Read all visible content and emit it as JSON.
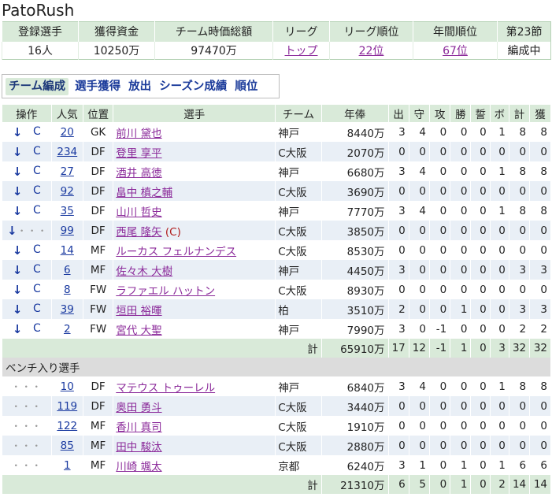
{
  "title": "PatoRush",
  "summary": {
    "headers": [
      "登録選手",
      "獲得資金",
      "チーム時価総額",
      "リーグ",
      "リーグ順位",
      "年間順位",
      "第23節"
    ],
    "values": [
      "16人",
      "10250万",
      "97470万",
      "トップ",
      "22位",
      "67位",
      "編成中"
    ]
  },
  "tabs": [
    "チーム編成",
    "選手獲得",
    "放出",
    "シーズン成績",
    "順位"
  ],
  "roster": {
    "headers": [
      "操作",
      "人気",
      "位置",
      "選手",
      "チーム",
      "年俸",
      "出",
      "守",
      "攻",
      "勝",
      "誓",
      "ボ",
      "計",
      "獲"
    ],
    "op_down": "↓",
    "op_c": "C",
    "op_dots": "・・・",
    "captain_mark": "(C)",
    "starters": [
      {
        "pop": "20",
        "pos": "GK",
        "name": "前川 黛也",
        "team": "神戸",
        "salary": "8440万",
        "s": [
          "3",
          "4",
          "0",
          "0",
          "0",
          "1",
          "8",
          "8"
        ],
        "ops": "arrow-c"
      },
      {
        "pop": "234",
        "pos": "DF",
        "name": "登里 享平",
        "team": "C大阪",
        "salary": "2070万",
        "s": [
          "0",
          "0",
          "0",
          "0",
          "0",
          "0",
          "0",
          "0"
        ],
        "ops": "arrow-c"
      },
      {
        "pop": "27",
        "pos": "DF",
        "name": "酒井 高徳",
        "team": "神戸",
        "salary": "6680万",
        "s": [
          "3",
          "4",
          "0",
          "0",
          "0",
          "1",
          "8",
          "8"
        ],
        "ops": "arrow-c"
      },
      {
        "pop": "92",
        "pos": "DF",
        "name": "畠中 槙之輔",
        "team": "C大阪",
        "salary": "3690万",
        "s": [
          "0",
          "0",
          "0",
          "0",
          "0",
          "0",
          "0",
          "0"
        ],
        "ops": "arrow-c"
      },
      {
        "pop": "35",
        "pos": "DF",
        "name": "山川 哲史",
        "team": "神戸",
        "salary": "7770万",
        "s": [
          "3",
          "4",
          "0",
          "0",
          "0",
          "1",
          "8",
          "8"
        ],
        "ops": "arrow-c"
      },
      {
        "pop": "99",
        "pos": "DF",
        "name": "西尾 隆矢",
        "team": "C大阪",
        "salary": "3850万",
        "s": [
          "0",
          "0",
          "0",
          "0",
          "0",
          "0",
          "0",
          "0"
        ],
        "ops": "arrow-dots",
        "captain": true
      },
      {
        "pop": "14",
        "pos": "MF",
        "name": "ルーカス フェルナンデス",
        "team": "C大阪",
        "salary": "8530万",
        "s": [
          "0",
          "0",
          "0",
          "0",
          "0",
          "0",
          "0",
          "0"
        ],
        "ops": "arrow-c"
      },
      {
        "pop": "6",
        "pos": "MF",
        "name": "佐々木 大樹",
        "team": "神戸",
        "salary": "4450万",
        "s": [
          "3",
          "0",
          "0",
          "0",
          "0",
          "0",
          "3",
          "3"
        ],
        "ops": "arrow-c"
      },
      {
        "pop": "8",
        "pos": "FW",
        "name": "ラファエル ハットン",
        "team": "C大阪",
        "salary": "8930万",
        "s": [
          "0",
          "0",
          "0",
          "0",
          "0",
          "0",
          "0",
          "0"
        ],
        "ops": "arrow-c"
      },
      {
        "pop": "39",
        "pos": "FW",
        "name": "垣田 裕暉",
        "team": "柏",
        "salary": "3510万",
        "s": [
          "2",
          "0",
          "0",
          "1",
          "0",
          "0",
          "3",
          "3"
        ],
        "ops": "arrow-c"
      },
      {
        "pop": "2",
        "pos": "FW",
        "name": "宮代 大聖",
        "team": "神戸",
        "salary": "7990万",
        "s": [
          "3",
          "0",
          "-1",
          "0",
          "0",
          "0",
          "2",
          "2"
        ],
        "ops": "arrow-c"
      }
    ],
    "starters_total": {
      "label": "計",
      "salary": "65910万",
      "s": [
        "17",
        "12",
        "-1",
        "1",
        "0",
        "3",
        "32",
        "32"
      ]
    },
    "bench_label": "ベンチ入り選手",
    "bench": [
      {
        "pop": "10",
        "pos": "DF",
        "name": "マテウス トゥーレル",
        "team": "神戸",
        "salary": "6840万",
        "s": [
          "3",
          "4",
          "0",
          "0",
          "0",
          "1",
          "8",
          "8"
        ],
        "ops": "dots"
      },
      {
        "pop": "119",
        "pos": "DF",
        "name": "奥田 勇斗",
        "team": "C大阪",
        "salary": "3440万",
        "s": [
          "0",
          "0",
          "0",
          "0",
          "0",
          "0",
          "0",
          "0"
        ],
        "ops": "dots"
      },
      {
        "pop": "122",
        "pos": "MF",
        "name": "香川 真司",
        "team": "C大阪",
        "salary": "1910万",
        "s": [
          "0",
          "0",
          "0",
          "0",
          "0",
          "0",
          "0",
          "0"
        ],
        "ops": "dots"
      },
      {
        "pop": "85",
        "pos": "MF",
        "name": "田中 駿汰",
        "team": "C大阪",
        "salary": "2880万",
        "s": [
          "0",
          "0",
          "0",
          "0",
          "0",
          "0",
          "0",
          "0"
        ],
        "ops": "dots"
      },
      {
        "pop": "1",
        "pos": "MF",
        "name": "川崎 颯太",
        "team": "京都",
        "salary": "6240万",
        "s": [
          "3",
          "1",
          "0",
          "1",
          "0",
          "1",
          "6",
          "6"
        ],
        "ops": "dots"
      }
    ],
    "bench_total": {
      "label": "計",
      "salary": "21310万",
      "s": [
        "6",
        "5",
        "0",
        "1",
        "0",
        "2",
        "14",
        "14"
      ]
    }
  }
}
